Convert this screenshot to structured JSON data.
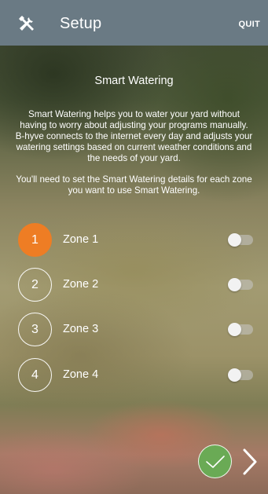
{
  "header": {
    "title": "Setup",
    "quit_label": "QUIT",
    "icon": "tools-icon",
    "bg_color": "#6a7a84"
  },
  "main": {
    "section_title": "Smart Watering",
    "description_1": "Smart Watering helps you to water your yard without having to worry about adjusting your programs manually. B-hyve connects to the internet every day and adjusts your watering settings based on current weather conditions and the needs of your yard.",
    "description_2": "You'll need to set the Smart Watering details for each zone you want to use Smart Watering."
  },
  "zones": [
    {
      "number": "1",
      "label": "Zone 1",
      "active": true,
      "enabled": false
    },
    {
      "number": "2",
      "label": "Zone 2",
      "active": false,
      "enabled": false
    },
    {
      "number": "3",
      "label": "Zone 3",
      "active": false,
      "enabled": false
    },
    {
      "number": "4",
      "label": "Zone 4",
      "active": false,
      "enabled": false
    }
  ],
  "footer": {
    "done_icon": "checkmark-icon",
    "next_icon": "chevron-right-icon"
  },
  "colors": {
    "accent": "#ee7d24",
    "confirm": "#6aaa55"
  }
}
